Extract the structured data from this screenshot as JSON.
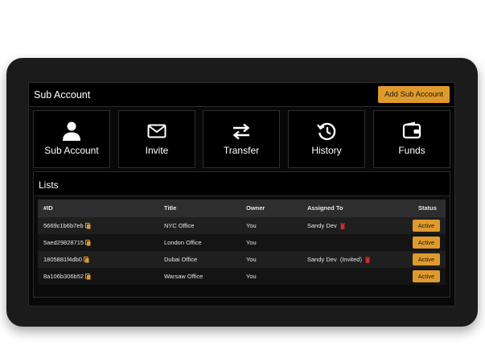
{
  "header": {
    "title": "Sub Account",
    "add_button": "Add Sub Account"
  },
  "tiles": [
    {
      "label": "Sub Account",
      "icon": "user-icon"
    },
    {
      "label": "Invite",
      "icon": "envelope-icon"
    },
    {
      "label": "Transfer",
      "icon": "transfer-arrows-icon"
    },
    {
      "label": "History",
      "icon": "history-icon"
    },
    {
      "label": "Funds",
      "icon": "wallet-icon"
    }
  ],
  "lists": {
    "title": "Lists",
    "columns": {
      "id": "#ID",
      "title": "Title",
      "owner": "Owner",
      "assigned": "Assigned To",
      "status": "Status"
    },
    "rows": [
      {
        "id": "5669c1b6b7eb",
        "title": "NYC Office",
        "owner": "You",
        "assigned": "Sandy Dev",
        "status": "Active"
      },
      {
        "id": "5aed29828715",
        "title": "London Office",
        "owner": "You",
        "assigned": "",
        "status": "Active"
      },
      {
        "id": "1805881f4db0",
        "title": "Dubai Office",
        "owner": "You",
        "assigned": "Sandy Dev  (Invited)",
        "status": "Active"
      },
      {
        "id": "8a106b306b52",
        "title": "Warsaw Office",
        "owner": "You",
        "assigned": "",
        "status": "Active"
      }
    ]
  },
  "colors": {
    "accent": "#e09a2c",
    "danger": "#c9302c",
    "background": "#1b1b1b"
  }
}
